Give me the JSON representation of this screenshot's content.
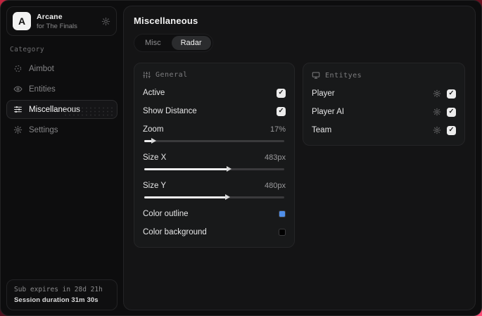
{
  "sidebar": {
    "app": {
      "initial": "A",
      "name": "Arcane",
      "subtitle": "for The Finals"
    },
    "category_label": "Category",
    "items": [
      {
        "label": "Aimbot",
        "icon": "crosshair-icon"
      },
      {
        "label": "Entities",
        "icon": "eye-icon"
      },
      {
        "label": "Miscellaneous",
        "icon": "sliders-icon"
      },
      {
        "label": "Settings",
        "icon": "gear-icon"
      }
    ],
    "footer": {
      "sub_expiry": "Sub expires in 28d 21h",
      "session_duration": "Session duration 31m 30s"
    }
  },
  "main": {
    "title": "Miscellaneous",
    "tabs": [
      {
        "label": "Misc"
      },
      {
        "label": "Radar"
      }
    ],
    "general": {
      "header": "General",
      "active": {
        "label": "Active",
        "checked": true
      },
      "show_distance": {
        "label": "Show Distance",
        "checked": true
      },
      "zoom": {
        "label": "Zoom",
        "value": "17%",
        "fill": "6%"
      },
      "size_x": {
        "label": "Size X",
        "value": "483px",
        "fill": "60%"
      },
      "size_y": {
        "label": "Size Y",
        "value": "480px",
        "fill": "59%"
      },
      "color_outline": {
        "label": "Color outline",
        "swatch": "#4f8ee8"
      },
      "color_background": {
        "label": "Color background",
        "swatch": "#000000"
      }
    },
    "entities_panel": {
      "header": "Entityes",
      "rows": [
        {
          "label": "Player",
          "checked": true
        },
        {
          "label": "Player AI",
          "checked": true
        },
        {
          "label": "Team",
          "checked": true
        }
      ]
    }
  },
  "glyphs": {
    "check": "✓"
  },
  "colors": {
    "outline_swatch": "#4f8ee8",
    "background_swatch": "#000000",
    "accent_corner": "#c2243f"
  }
}
